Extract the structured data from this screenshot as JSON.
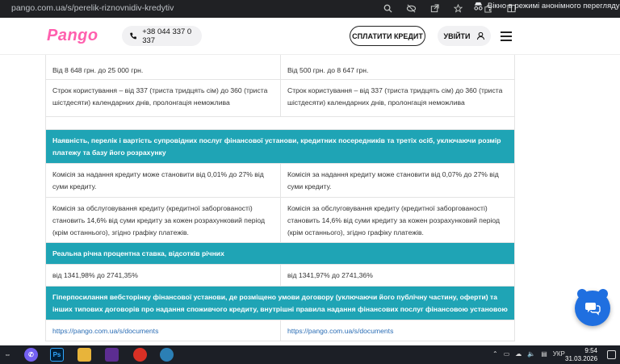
{
  "browser": {
    "url": "pango.com.ua/s/perelik-riznovnidiv-kredytiv",
    "incognito_label": "Вікно в режимі анонімного перегляду",
    "icons": [
      "search-icon",
      "eye-off-icon",
      "share-icon",
      "star-icon",
      "extensions-icon",
      "split-icon"
    ]
  },
  "header": {
    "logo": "Pango",
    "phone": "+38 044 337 0 337",
    "pay_label": "СПЛАТИТИ КРЕДИТ",
    "login_label": "УВІЙТИ"
  },
  "table": {
    "r1": {
      "a": "Від 8 648 грн. до 25 000 грн.",
      "b": "Від 500 грн. до 8 647 грн."
    },
    "r2": {
      "a": "Строк користування – від 337 (триста тридцять сім) до 360 (триста шістдесяти) календарних днів, пролонгація неможлива",
      "b": "Строк користування – від 337 (триста тридцять сім) до 360 (триста шістдесяти) календарних днів, пролонгація неможлива"
    },
    "h1": "Наявність, перелік і вартість супровідних послуг фінансової установи, кредитних посередників та третіх осіб, уключаючи розмір платежу та базу його розрахунку",
    "r3": {
      "a": "Комісія за надання кредиту може становити від 0,01% до 27% від суми кредиту.",
      "b": "Комісія за надання кредиту може становити від 0,07% до 27% від суми кредиту."
    },
    "r4": {
      "a": "Комісія за обслуговування кредиту (кредитної заборгованості) становить 14,6% від суми кредиту за кожен розрахунковий період (крім останнього), згідно графіку платежів.",
      "b": "Комісія за обслуговування кредиту (кредитної заборгованості) становить 14,6% від суми кредиту за кожен розрахунковий період (крім останнього), згідно графіку платежів."
    },
    "h2": "Реальна річна процентна ставка, відсотків річних",
    "r5": {
      "a": "від 1341,98% до 2741,35%",
      "b": "від 1341,97% до 2741,36%"
    },
    "h3": "Гіперпосилання вебсторінку фінансової установи, де розміщено умови договору (уключаючи його публічну частину, оферти) та інших типових договорів про надання споживчого кредиту, внутрішні правила надання фінансових послуг фінансовою установою",
    "r6": {
      "a": "https://pango.com.ua/s/documents",
      "b": "https://pango.com.ua/s/documents"
    }
  },
  "taskbar": {
    "lang": "УКР",
    "time": "9:54",
    "date": "31.03.2026"
  },
  "colors": {
    "accent": "#1fa4b5",
    "brand": "#ff5fae",
    "chat": "#1f6fe0"
  }
}
